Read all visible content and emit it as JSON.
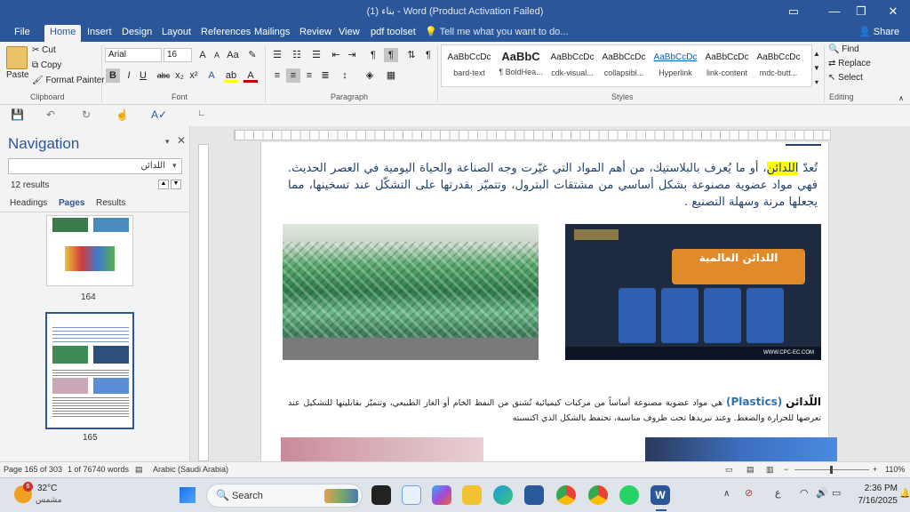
{
  "window": {
    "title": "(1) بناء - Word (Product Activation Failed)"
  },
  "tabs": [
    "File",
    "Home",
    "Insert",
    "Design",
    "Layout",
    "References",
    "Mailings",
    "Review",
    "View",
    "pdf toolset"
  ],
  "tell_me": "Tell me what you want to do...",
  "share_label": "Share",
  "clipboard": {
    "paste": "Paste",
    "cut": "Cut",
    "copy": "Copy",
    "format_painter": "Format Painter",
    "label": "Clipboard"
  },
  "font": {
    "name": "Arial",
    "size": "16",
    "label": "Font"
  },
  "paragraph": {
    "label": "Paragraph"
  },
  "styles": {
    "label": "Styles",
    "items": [
      {
        "sample": "AaBbCcDc",
        "name": "bard-text"
      },
      {
        "sample": "AaBbC",
        "name": "¶ BoldHea..."
      },
      {
        "sample": "AaBbCcDc",
        "name": "cdk-visual..."
      },
      {
        "sample": "AaBbCcDc",
        "name": "collapsibl..."
      },
      {
        "sample": "AaBbCcDc",
        "name": "Hyperlink"
      },
      {
        "sample": "AaBbCcDc",
        "name": "link-content"
      },
      {
        "sample": "AaBbCcDc",
        "name": "mdc-butt..."
      }
    ]
  },
  "editing": {
    "find": "Find",
    "replace": "Replace",
    "select": "Select",
    "label": "Editing"
  },
  "nav": {
    "title": "Navigation",
    "search_value": "اللدائن",
    "results": "12 results",
    "tabs": [
      "Headings",
      "Pages",
      "Results"
    ],
    "pages": [
      "164",
      "165"
    ]
  },
  "doc": {
    "p1_lead": "تُعدّ ",
    "p1_hl": "اللدائن",
    "p1_rest": "، أو ما يُعرف بالبلاستيك، من أهم المواد التي غيّرت وجه الصناعة والحياة اليومية في العصر الحديث. فهي مواد عضوية مصنوعة بشكل أساسي من مشتقات البترول، وتتميّز بقدرتها على التشكّل عند تسخينها، مما يجعلها مرنة وسهلة التصنيع .",
    "p2_term": "اللّدائن",
    "p2_en": "(Plastics)",
    "p2_rest": " هي مواد عضوية مصنوعة أساساً من مركبات كيميائية تُشتق من النفط الخام أو الغاز الطبيعي، وتتميّز بقابليتها للتشكيل عند تعرضها للحرارة والضغط. وعند تبريدها تحت ظروف مناسبة، تحتفظ بالشكل الذي اكتسبته",
    "poster_title": "اللدائن العالمية",
    "poster_url": "WWW.CPC-EC.COM"
  },
  "status": {
    "page": "Page 165 of 303",
    "words": "1 of 76740 words",
    "language": "Arabic (Saudi Arabia)",
    "zoom": "110%"
  },
  "taskbar": {
    "weather_temp": "32°C",
    "weather_desc": "مشمس",
    "badge": "6",
    "search": "Search",
    "time": "2:36 PM",
    "date": "7/16/2025",
    "lang": "ع"
  },
  "colors": {
    "accent": "#2b579a",
    "highlight": "#ffff00",
    "body_text": "#1f3f6e"
  }
}
